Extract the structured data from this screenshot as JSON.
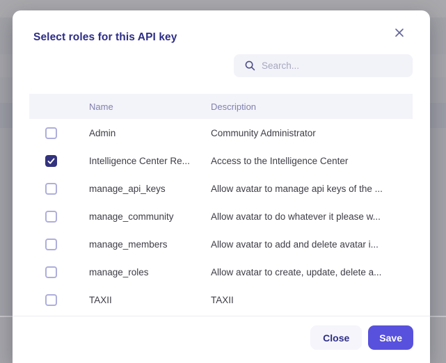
{
  "colors": {
    "accent": "#5851dd",
    "title": "#2d2d87",
    "checked": "#32327e"
  },
  "icons": {
    "close": "x-mark",
    "search": "magnifier",
    "checkbox_checked": "checkmark"
  },
  "modal": {
    "title": "Select roles for this API key",
    "search": {
      "placeholder": "Search...",
      "value": ""
    },
    "table": {
      "columns": [
        "Name",
        "Description"
      ],
      "rows": [
        {
          "name": "Admin",
          "description": "Community Administrator",
          "checked": false
        },
        {
          "name": "Intelligence Center Re...",
          "description": "Access to the Intelligence Center",
          "checked": true
        },
        {
          "name": "manage_api_keys",
          "description": "Allow avatar to manage api keys of the ...",
          "checked": false
        },
        {
          "name": "manage_community",
          "description": "Allow avatar to do whatever it please w...",
          "checked": false
        },
        {
          "name": "manage_members",
          "description": "Allow avatar to add and delete avatar i...",
          "checked": false
        },
        {
          "name": "manage_roles",
          "description": "Allow avatar to create, update, delete a...",
          "checked": false
        },
        {
          "name": "TAXII",
          "description": "TAXII",
          "checked": false
        }
      ]
    },
    "footer": {
      "close_label": "Close",
      "save_label": "Save"
    }
  }
}
